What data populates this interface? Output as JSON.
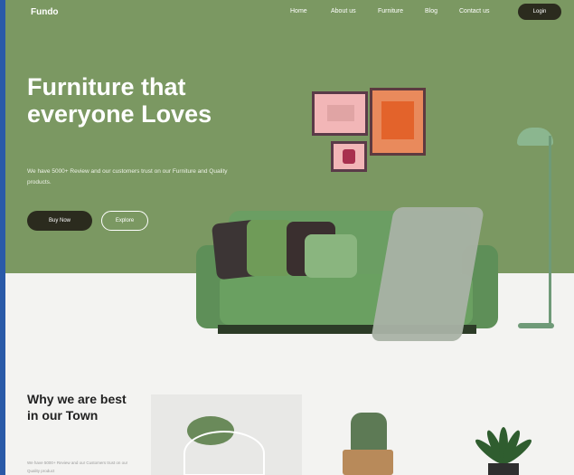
{
  "nav": {
    "logo": "Fundo",
    "links": [
      "Home",
      "About us",
      "Furniture",
      "Blog",
      "Contact us"
    ],
    "login": "Login"
  },
  "hero": {
    "title": "Furniture that everyone Loves",
    "subtitle": "We have 5000+ Review and our customers trust on our Furniture and Quality products.",
    "buy_now": "Buy Now",
    "explore": "Explore"
  },
  "section": {
    "title": "Why we are best in our Town",
    "subtitle": "We have 5000+ Review and our Customers trust on our Quality product"
  },
  "colors": {
    "hero_bg": "#7b9862",
    "dark_button": "#2b2b1e",
    "floor": "#f3f3f1"
  }
}
